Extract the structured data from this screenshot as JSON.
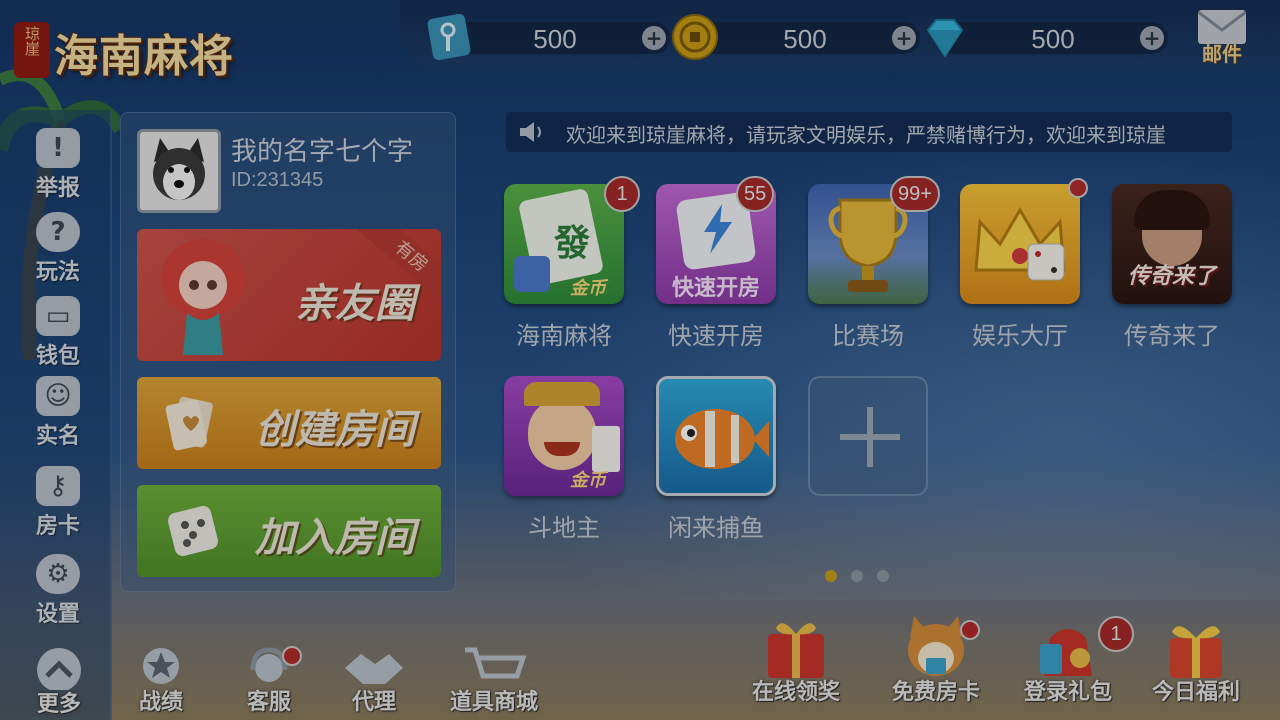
{
  "logo": {
    "seal": "琼崖",
    "title": "海南麻将"
  },
  "currencies": [
    {
      "id": "room-card",
      "value": "500",
      "icon": "room-card-key-icon",
      "color": "#3aa0c8"
    },
    {
      "id": "gold-coin",
      "value": "500",
      "icon": "gold-coin-icon",
      "color": "#d4a21a"
    },
    {
      "id": "diamond",
      "value": "500",
      "icon": "diamond-icon",
      "color": "#3fc4e6"
    }
  ],
  "plus_glyph": "+",
  "mail": {
    "label": "邮件",
    "icon": "mail-envelope-icon"
  },
  "sidebar": {
    "items": [
      {
        "label": "举报",
        "icon": "report-shield-icon",
        "glyph": "!"
      },
      {
        "label": "玩法",
        "icon": "rules-question-icon",
        "glyph": "?"
      },
      {
        "label": "钱包",
        "icon": "wallet-icon",
        "glyph": "▭"
      },
      {
        "label": "实名",
        "icon": "real-name-user-icon",
        "glyph": "☺"
      },
      {
        "label": "房卡",
        "icon": "room-card-icon",
        "glyph": "⚷"
      },
      {
        "label": "设置",
        "icon": "settings-gear-icon",
        "glyph": "⚙"
      }
    ]
  },
  "profile": {
    "name": "我的名字七个字",
    "id": "ID:231345"
  },
  "room_buttons": {
    "friends": {
      "label": "亲友圈",
      "ribbon": "有房"
    },
    "create": {
      "label": "创建房间"
    },
    "join": {
      "label": "加入房间"
    }
  },
  "notice": {
    "text": "欢迎来到琼崖麻将，请玩家文明娱乐，严禁赌博行为，欢迎来到琼崖"
  },
  "games": [
    {
      "label": "海南麻将",
      "badge": "1",
      "tile_text": "金币"
    },
    {
      "label": "快速开房",
      "badge": "55",
      "tile_text": "快速开房"
    },
    {
      "label": "比赛场",
      "badge": "99+",
      "tile_text": ""
    },
    {
      "label": "娱乐大厅",
      "badge": "",
      "tile_text": ""
    },
    {
      "label": "传奇来了",
      "badge": "",
      "tile_text": "传奇来了"
    },
    {
      "label": "斗地主",
      "badge": "",
      "tile_text": "金币"
    },
    {
      "label": "闲来捕鱼",
      "badge": "",
      "tile_text": ""
    }
  ],
  "pager": {
    "pages": 3,
    "current": 1
  },
  "bottom_left": [
    {
      "label": "更多",
      "icon": "more-up-arrow-icon"
    },
    {
      "label": "战绩",
      "icon": "record-star-icon"
    },
    {
      "label": "客服",
      "icon": "customer-service-headset-icon"
    },
    {
      "label": "代理",
      "icon": "agent-handshake-icon"
    },
    {
      "label": "道具商城",
      "icon": "shop-cart-icon"
    }
  ],
  "bottom_right": [
    {
      "label": "在线领奖",
      "icon": "online-reward-gift-icon",
      "badge": ""
    },
    {
      "label": "免费房卡",
      "icon": "free-room-card-dog-icon",
      "badge": ""
    },
    {
      "label": "登录礼包",
      "icon": "login-gift-bag-icon",
      "badge": "1"
    },
    {
      "label": "今日福利",
      "icon": "daily-welfare-gift-icon",
      "badge": ""
    }
  ]
}
